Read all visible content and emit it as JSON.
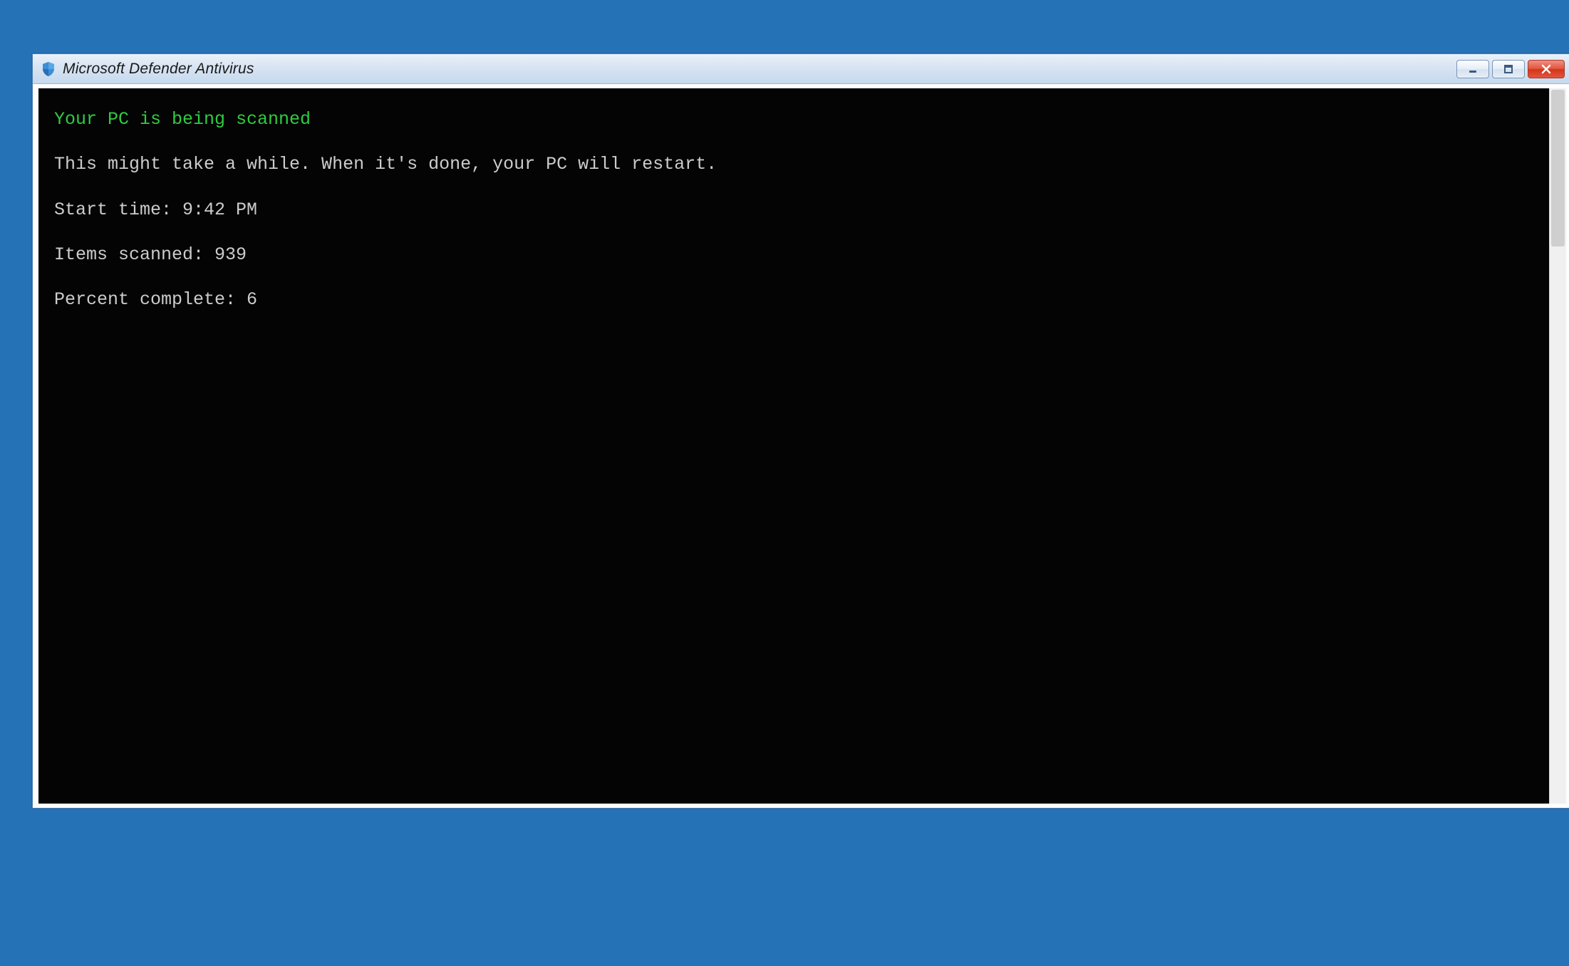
{
  "window": {
    "title": "Microsoft Defender Antivirus"
  },
  "console": {
    "heading": "Your PC is being scanned",
    "message": "This might take a while. When it's done, your PC will restart.",
    "start_label": "Start time: ",
    "start_value": "9:42 PM",
    "items_label": "Items scanned: ",
    "items_value": "939",
    "percent_label": "Percent complete: ",
    "percent_value": "6"
  }
}
